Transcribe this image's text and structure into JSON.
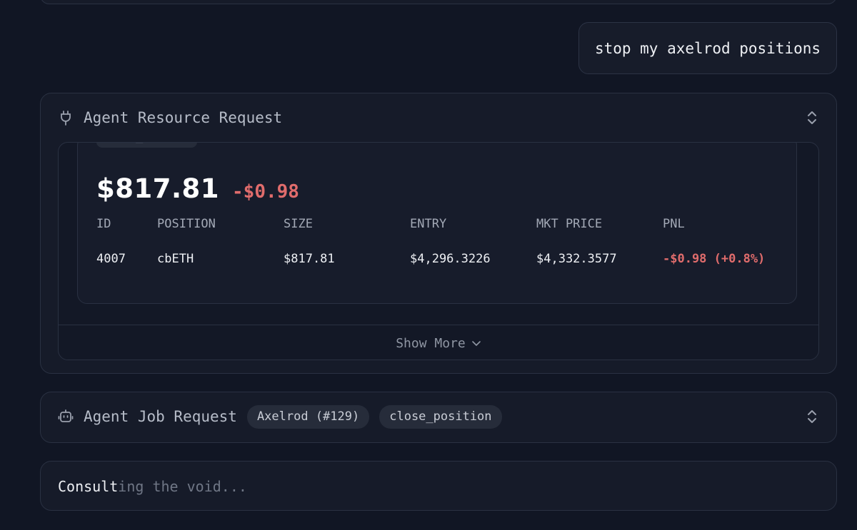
{
  "user_message": "stop my axelrod positions",
  "resource_request": {
    "title": "Agent Resource Request",
    "tag": "spot_trader",
    "value": "$817.81",
    "delta": "-$0.98",
    "columns": [
      "ID",
      "POSITION",
      "SIZE",
      "ENTRY",
      "MKT PRICE",
      "PNL"
    ],
    "rows": [
      {
        "id": "4007",
        "position": "cbETH",
        "size": "$817.81",
        "entry": "$4,296.3226",
        "mkt_price": "$4,332.3577",
        "pnl": "-$0.98 (+0.8%)"
      }
    ],
    "show_more": "Show More"
  },
  "job_request": {
    "title": "Agent Job Request",
    "agent_pill": "Axelrod (#129)",
    "action_pill": "close_position"
  },
  "status": {
    "bright": "Consult",
    "dim": "ing the void..."
  },
  "colors": {
    "background": "#111624",
    "card": "#161b29",
    "negative": "#e06c6c"
  }
}
